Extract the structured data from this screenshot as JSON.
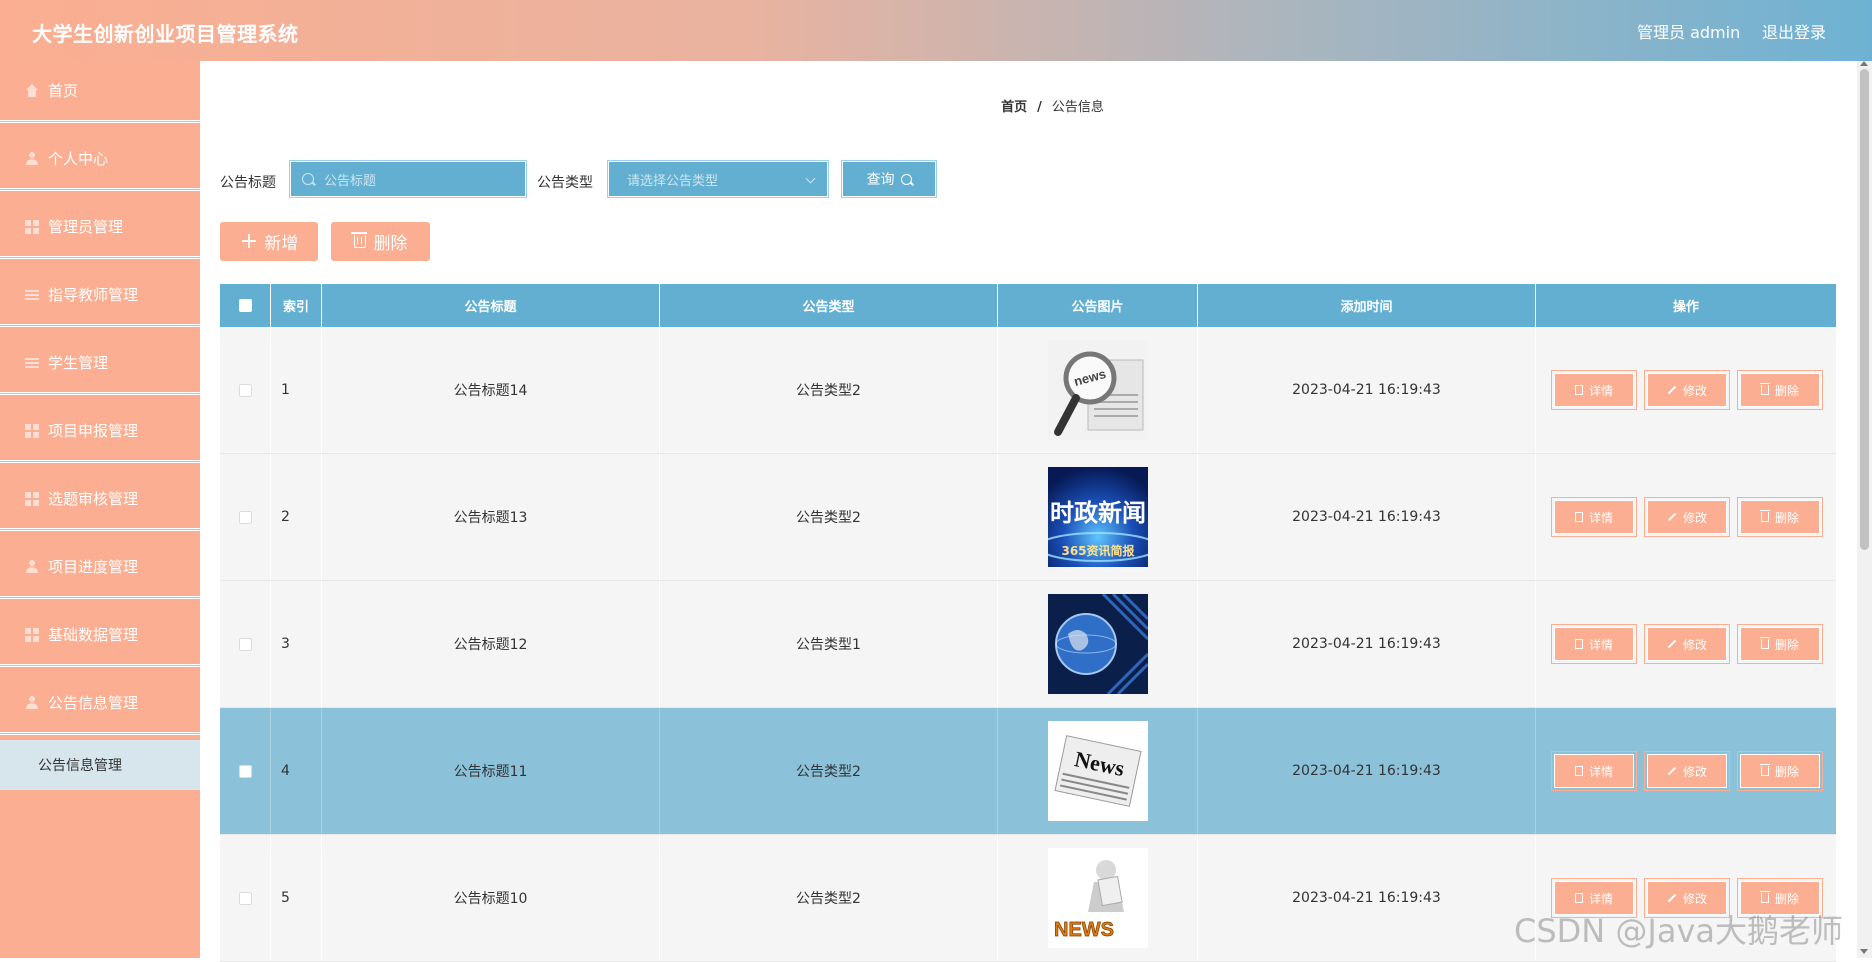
{
  "header": {
    "title": "大学生创新创业项目管理系统",
    "user": "管理员 admin",
    "logout": "退出登录"
  },
  "sidebar": {
    "items": [
      {
        "label": "首页",
        "icon": "home-icon"
      },
      {
        "label": "个人中心",
        "icon": "user-icon"
      },
      {
        "label": "管理员管理",
        "icon": "grid-icon"
      },
      {
        "label": "指导教师管理",
        "icon": "list-icon"
      },
      {
        "label": "学生管理",
        "icon": "list-icon"
      },
      {
        "label": "项目申报管理",
        "icon": "grid-icon"
      },
      {
        "label": "选题审核管理",
        "icon": "grid-icon"
      },
      {
        "label": "项目进度管理",
        "icon": "user-icon"
      },
      {
        "label": "基础数据管理",
        "icon": "grid-icon"
      },
      {
        "label": "公告信息管理",
        "icon": "user-icon"
      }
    ],
    "sub_item": "公告信息管理"
  },
  "breadcrumb": {
    "home": "首页",
    "separator": "/",
    "current": "公告信息"
  },
  "search": {
    "title_label": "公告标题",
    "title_placeholder": "公告标题",
    "type_label": "公告类型",
    "type_placeholder": "请选择公告类型",
    "query_label": "查询"
  },
  "actions": {
    "add": "新增",
    "delete": "删除"
  },
  "table": {
    "headers": [
      "索引",
      "公告标题",
      "公告类型",
      "公告图片",
      "添加时间",
      "操作"
    ],
    "rows": [
      {
        "index": "1",
        "title": "公告标题14",
        "type": "公告类型2",
        "time": "2023-04-21 16:19:43",
        "image": "news-magnifier-icon"
      },
      {
        "index": "2",
        "title": "公告标题13",
        "type": "公告类型2",
        "time": "2023-04-21 16:19:43",
        "image": "political-news-banner",
        "image_text": "时政新闻",
        "image_subtext": "365资讯简报"
      },
      {
        "index": "3",
        "title": "公告标题12",
        "type": "公告类型1",
        "time": "2023-04-21 16:19:43",
        "image": "globe-news-icon"
      },
      {
        "index": "4",
        "title": "公告标题11",
        "type": "公告类型2",
        "time": "2023-04-21 16:19:43",
        "image": "newspaper-icon",
        "image_text": "News"
      },
      {
        "index": "5",
        "title": "公告标题10",
        "type": "公告类型2",
        "time": "2023-04-21 16:19:43",
        "image": "news-figure-icon",
        "image_text": "NEWS"
      }
    ],
    "ops": {
      "detail": "详情",
      "edit": "修改",
      "delete": "删除"
    }
  },
  "watermark": "CSDN @Java大鹅老师",
  "colors": {
    "accent": "#fbae91",
    "table_header": "#62afd2",
    "highlight_row": "#8bc2da"
  }
}
